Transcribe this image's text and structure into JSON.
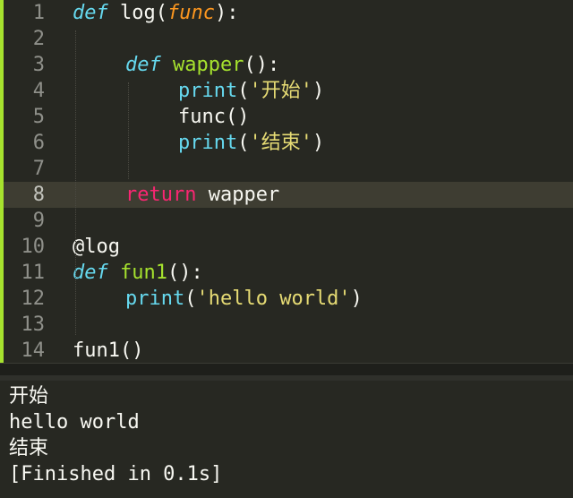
{
  "editor": {
    "language": "python",
    "active_line": 8,
    "lines": [
      {
        "n": "1",
        "code": [
          "def",
          " ",
          "log",
          "(",
          "func",
          "):"
        ]
      },
      {
        "n": "2",
        "code": []
      },
      {
        "n": "3",
        "code": [
          "def",
          " ",
          "wapper",
          "():"
        ]
      },
      {
        "n": "4",
        "code": [
          "print",
          "(",
          "'开始'",
          ")"
        ]
      },
      {
        "n": "5",
        "code": [
          "func()"
        ]
      },
      {
        "n": "6",
        "code": [
          "print",
          "(",
          "'结束'",
          ")"
        ]
      },
      {
        "n": "7",
        "code": []
      },
      {
        "n": "8",
        "code": [
          "return",
          " wapper"
        ]
      },
      {
        "n": "9",
        "code": []
      },
      {
        "n": "10",
        "code": [
          "@log"
        ]
      },
      {
        "n": "11",
        "code": [
          "def",
          " ",
          "fun1",
          "():"
        ]
      },
      {
        "n": "12",
        "code": [
          "print",
          "(",
          "'hello world'",
          ")"
        ]
      },
      {
        "n": "13",
        "code": []
      },
      {
        "n": "14",
        "code": [
          "fun1()"
        ]
      }
    ]
  },
  "console": {
    "lines": [
      "开始",
      "hello world",
      "结束",
      "[Finished in 0.1s]"
    ]
  },
  "colors": {
    "background": "#272822",
    "keyword_def": "#66d9ef",
    "keyword_return": "#f92672",
    "function_name": "#a6e22e",
    "parameter": "#fd971f",
    "string": "#e6db74",
    "text": "#f8f8f2",
    "line_number": "#8f908a",
    "active_line": "#3e3d32",
    "gutter_bar": "#a6e22e"
  }
}
